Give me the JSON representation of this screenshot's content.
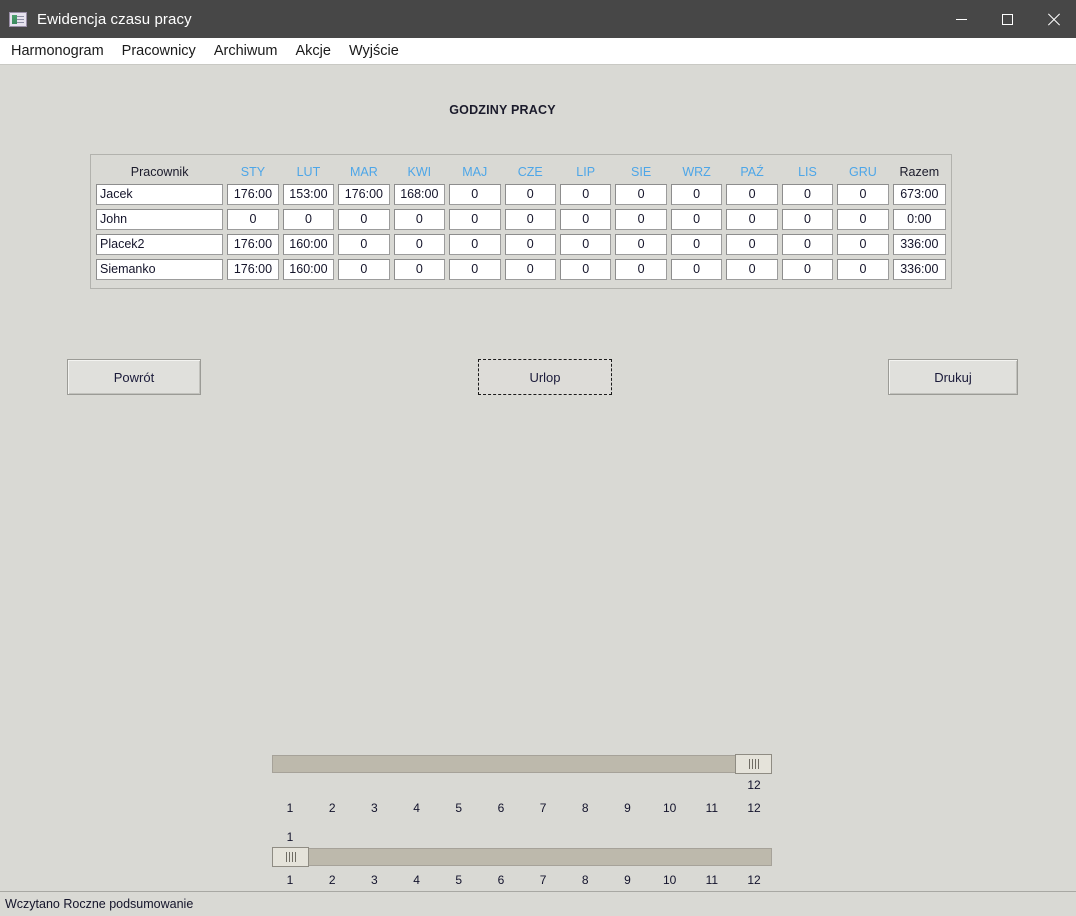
{
  "window": {
    "title": "Ewidencja czasu pracy",
    "icon": "id-card-icon",
    "minimize_label": "—",
    "maximize_label": "□",
    "close_label": "✕"
  },
  "menubar": {
    "items": [
      {
        "label": "Harmonogram"
      },
      {
        "label": "Pracownicy"
      },
      {
        "label": "Archiwum"
      },
      {
        "label": "Akcje"
      },
      {
        "label": "Wyjście"
      }
    ]
  },
  "main": {
    "page_title": "GODZINY PRACY",
    "table": {
      "headers": [
        "Pracownik",
        "STY",
        "LUT",
        "MAR",
        "KWI",
        "MAJ",
        "CZE",
        "LIP",
        "SIE",
        "WRZ",
        "PAŹ",
        "LIS",
        "GRU",
        "Razem"
      ],
      "rows": [
        {
          "name": "Jacek",
          "months": [
            "176:00",
            "153:00",
            "176:00",
            "168:00",
            "0",
            "0",
            "0",
            "0",
            "0",
            "0",
            "0",
            "0"
          ],
          "total": "673:00"
        },
        {
          "name": "John",
          "months": [
            "0",
            "0",
            "0",
            "0",
            "0",
            "0",
            "0",
            "0",
            "0",
            "0",
            "0",
            "0"
          ],
          "total": "0:00"
        },
        {
          "name": "Placek2",
          "months": [
            "176:00",
            "160:00",
            "0",
            "0",
            "0",
            "0",
            "0",
            "0",
            "0",
            "0",
            "0",
            "0"
          ],
          "total": "336:00"
        },
        {
          "name": "Siemanko",
          "months": [
            "176:00",
            "160:00",
            "0",
            "0",
            "0",
            "0",
            "0",
            "0",
            "0",
            "0",
            "0",
            "0"
          ],
          "total": "336:00"
        }
      ]
    },
    "buttons": {
      "back": "Powrót",
      "vacation": "Urlop",
      "print": "Drukuj"
    },
    "sliders": {
      "top": {
        "value": "12",
        "min": 1,
        "max": 12,
        "ticks": [
          "1",
          "2",
          "3",
          "4",
          "5",
          "6",
          "7",
          "8",
          "9",
          "10",
          "11",
          "12"
        ]
      },
      "bottom": {
        "value": "1",
        "min": 1,
        "max": 12,
        "ticks": [
          "1",
          "2",
          "3",
          "4",
          "5",
          "6",
          "7",
          "8",
          "9",
          "10",
          "11",
          "12"
        ]
      }
    }
  },
  "statusbar": {
    "message": "Wczytano Roczne podsumowanie"
  },
  "colors": {
    "titlebar": "#474747",
    "panel": "#d9d9d4",
    "month_header": "#4da6e8",
    "text": "#14142a",
    "slider_track": "#bdb9ac"
  }
}
